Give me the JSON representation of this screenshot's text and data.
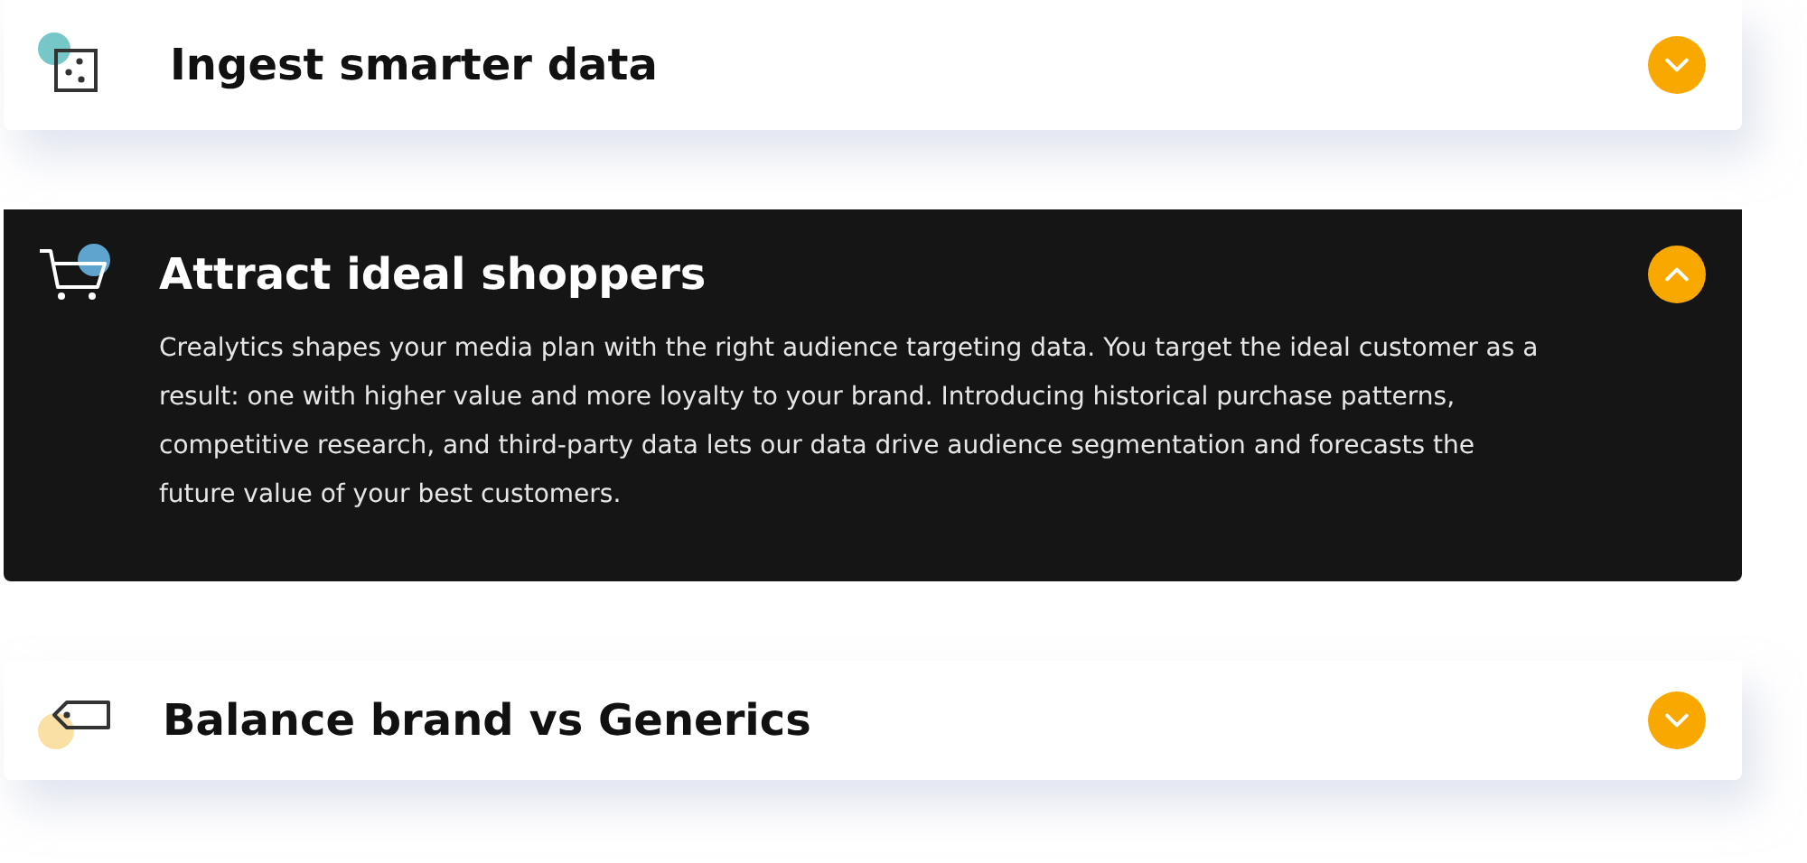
{
  "accordion": [
    {
      "title": "Ingest smarter data",
      "kind": "dice",
      "color": "#76c7c8",
      "expanded": false
    },
    {
      "title": "Attract ideal shoppers",
      "kind": "cart",
      "color": "#5fa3cf",
      "expanded": true,
      "body": "Crealytics shapes your media plan with the right audience targeting data. You target the ideal customer as a result: one with higher value and more loyalty to your brand. Introducing historical purchase patterns, competitive research, and third-party data lets our data drive audience segmentation and forecasts the future value of your best customers."
    },
    {
      "title": "Balance brand vs Generics",
      "kind": "tag",
      "color": "#fbe0a6",
      "expanded": false
    }
  ]
}
